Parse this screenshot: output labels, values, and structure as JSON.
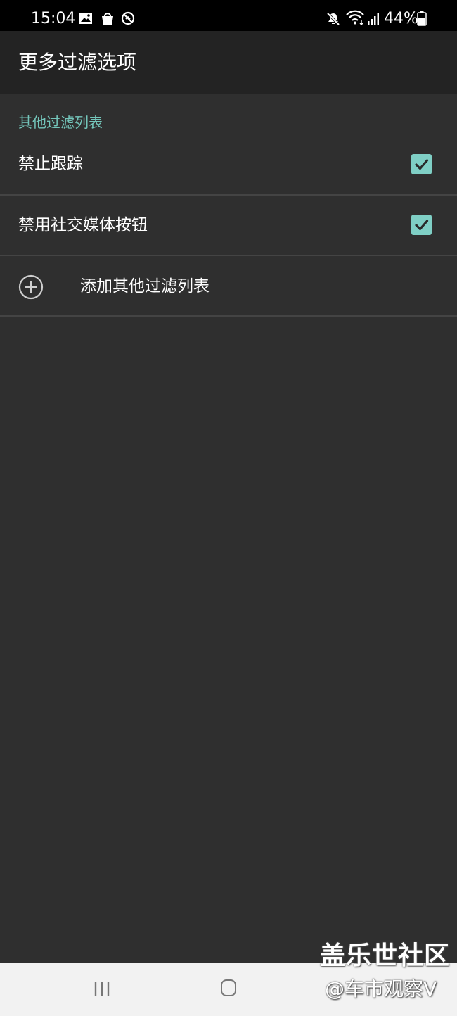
{
  "status_bar": {
    "time": "15:04",
    "battery": "44%",
    "icons": [
      "image-icon",
      "shopping-bag-icon",
      "no-tracking-icon",
      "mute-icon",
      "wifi-icon",
      "signal-icon",
      "battery-icon"
    ]
  },
  "app_bar": {
    "title": "更多过滤选项"
  },
  "section": {
    "header": "其他过滤列表",
    "items": [
      {
        "label": "禁止跟踪",
        "checked": true
      },
      {
        "label": "禁用社交媒体按钮",
        "checked": true
      }
    ],
    "add_label": "添加其他过滤列表"
  },
  "colors": {
    "accent": "#74c6bb",
    "checkbox": "#7fcfc5",
    "background": "#2f2f2f",
    "app_bar": "#232323"
  },
  "watermark": {
    "line1": "盖乐世社区",
    "line2": "@车市观察V"
  }
}
